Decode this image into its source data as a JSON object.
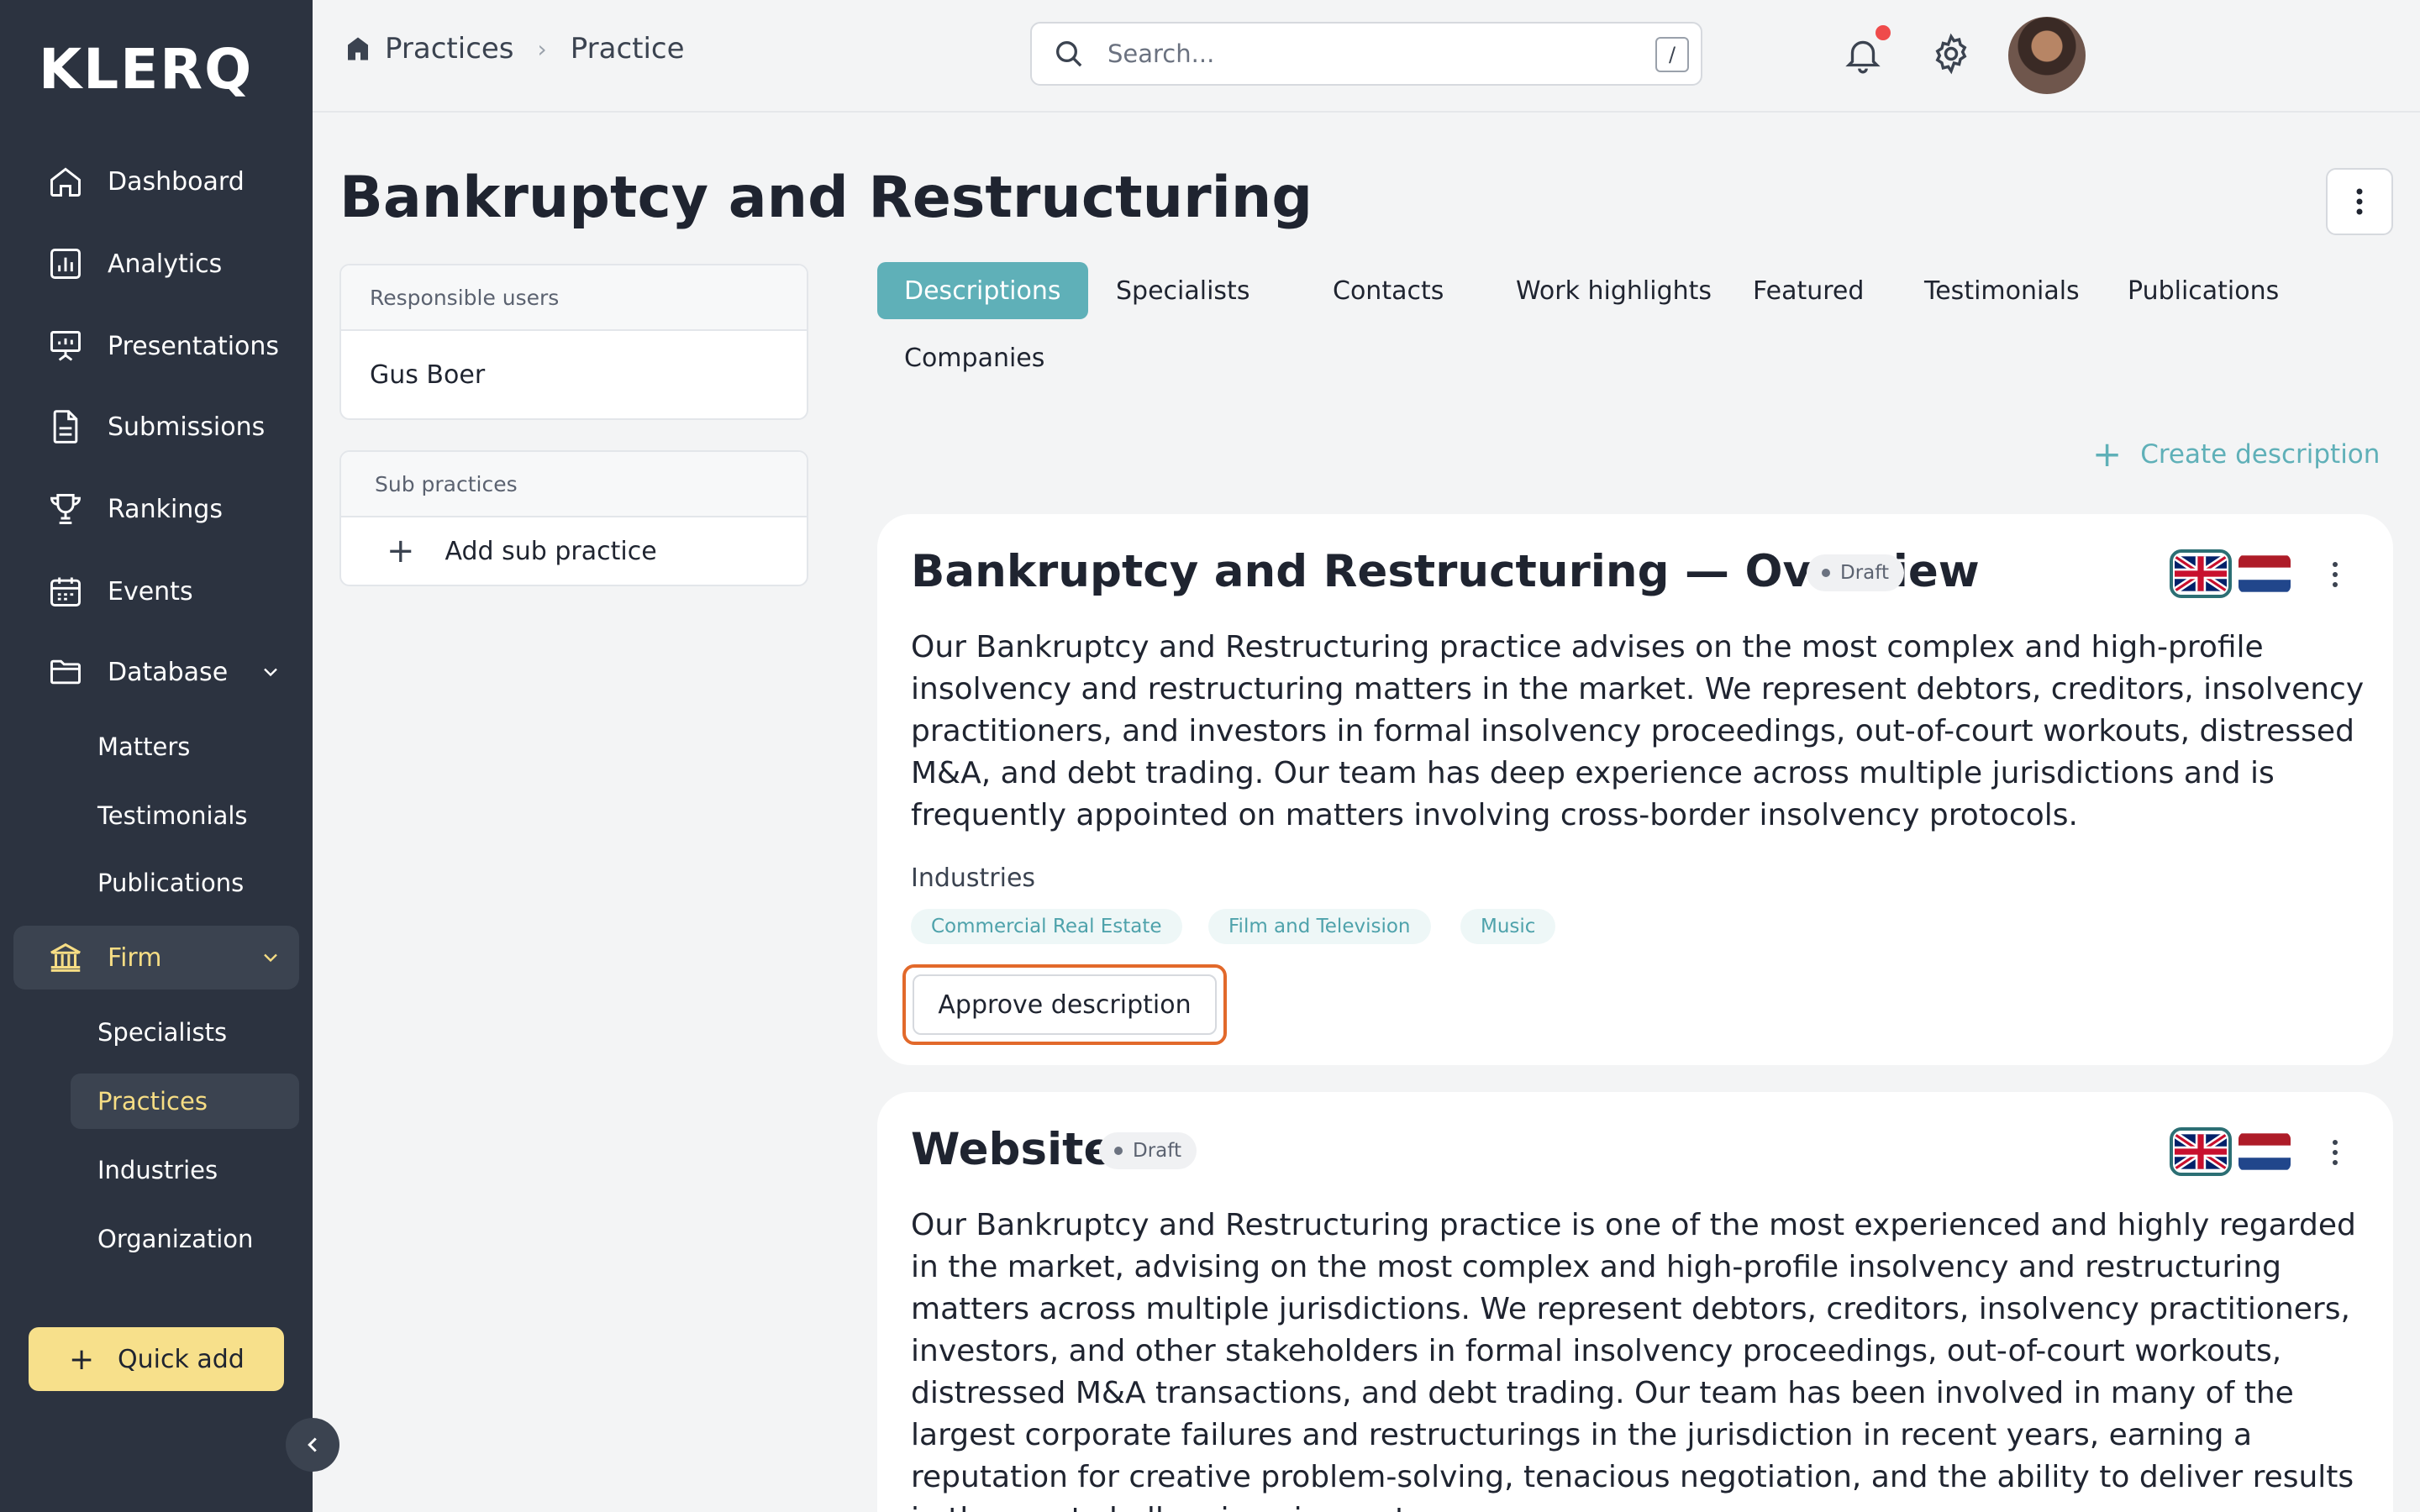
{
  "app": {
    "logo": "KLERQ"
  },
  "sidebar": {
    "items": [
      {
        "label": "Dashboard",
        "icon": "home-icon"
      },
      {
        "label": "Analytics",
        "icon": "bar-chart-icon"
      },
      {
        "label": "Presentations",
        "icon": "presentation-icon"
      },
      {
        "label": "Submissions",
        "icon": "document-icon"
      },
      {
        "label": "Rankings",
        "icon": "trophy-icon"
      },
      {
        "label": "Events",
        "icon": "calendar-icon"
      },
      {
        "label": "Database",
        "icon": "folder-icon"
      }
    ],
    "database_children": [
      "Matters",
      "Testimonials",
      "Publications"
    ],
    "firm": {
      "label": "Firm",
      "icon": "bank-icon"
    },
    "firm_children": [
      "Specialists",
      "Practices",
      "Industries",
      "Organization"
    ],
    "quick_add": "Quick add"
  },
  "header": {
    "breadcrumb": [
      "Practices",
      "Practice"
    ],
    "search_placeholder": "Search...",
    "search_shortcut": "/"
  },
  "page": {
    "title": "Bankruptcy and Restructuring"
  },
  "left_panels": {
    "responsible_users": {
      "header": "Responsible users",
      "user": "Gus Boer"
    },
    "sub_practices": {
      "header": "Sub practices",
      "add_label": "Add sub practice"
    }
  },
  "tabs": [
    "Descriptions",
    "Specialists",
    "Contacts",
    "Work highlights",
    "Featured",
    "Testimonials",
    "Publications",
    "Companies"
  ],
  "active_tab": "Descriptions",
  "create_description": "Create description",
  "descriptions": [
    {
      "title": "Bankruptcy and Restructuring — Overview",
      "status": "Draft",
      "text": "Our Bankruptcy and Restructuring practice advises on the most complex and high-profile insolvency and restructuring matters in the market. We represent debtors, creditors, insolvency practitioners, and investors in formal insolvency proceedings, out-of-court workouts, distressed M&A, and debt trading. Our team has deep experience across multiple jurisdictions and is frequently appointed on matters involving cross-border insolvency protocols.",
      "industries_label": "Industries",
      "industries": [
        "Commercial Real Estate",
        "Film and Television",
        "Music"
      ],
      "approve_label": "Approve description"
    },
    {
      "title": "Website",
      "status": "Draft",
      "text": "Our Bankruptcy and Restructuring practice is one of the most experienced and highly regarded in the market, advising on the most complex and high-profile insolvency and restructuring matters across multiple jurisdictions. We represent debtors, creditors, insolvency practitioners, investors, and other stakeholders in formal insolvency proceedings, out-of-court workouts, distressed M&A transactions, and debt trading. Our team has been involved in many of the largest corporate failures and restructurings in the jurisdiction in recent years, earning a reputation for creative problem-solving, tenacious negotiation, and the ability to deliver results in the most challenging circumstances."
    }
  ],
  "colors": {
    "sidebar_bg": "#2c3340",
    "accent_teal": "#5fb0b8",
    "highlight_yellow": "#f7e08b",
    "focus_orange": "#e2692b"
  }
}
